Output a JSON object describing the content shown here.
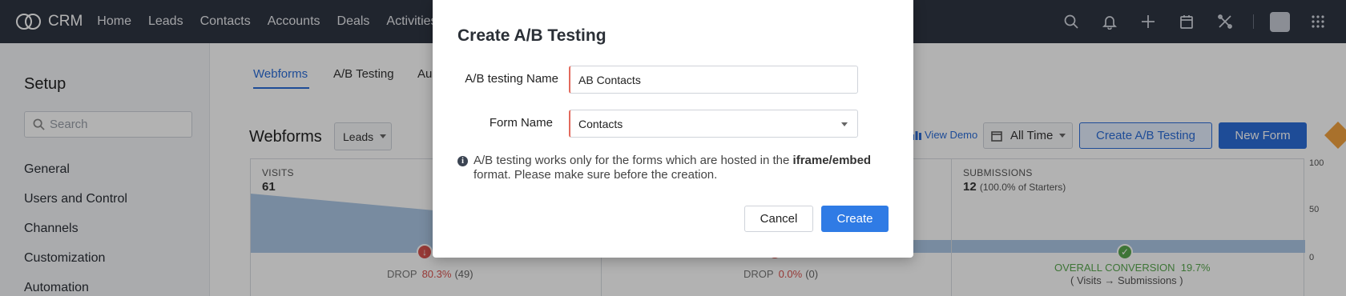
{
  "topnav": {
    "brand": "CRM",
    "links": [
      "Home",
      "Leads",
      "Contacts",
      "Accounts",
      "Deals",
      "Activities"
    ],
    "icons": [
      "search-icon",
      "bell-icon",
      "plus-icon",
      "calendar-icon",
      "tools-icon",
      "avatar",
      "apps-grid-icon"
    ]
  },
  "sidebar": {
    "title": "Setup",
    "search_placeholder": "Search",
    "items": [
      "General",
      "Users and Control",
      "Channels",
      "Customization",
      "Automation"
    ]
  },
  "main": {
    "tabs": [
      "Webforms",
      "A/B Testing",
      "Au"
    ],
    "active_tab": "Webforms",
    "page_title": "Webforms",
    "module_select": "Leads",
    "view_demo": "View Demo",
    "time_filter": "All Time",
    "create_ab_button": "Create A/B Testing",
    "new_form_button": "New Form",
    "funnel": {
      "visits_label": "VISITS",
      "visits_value": "61",
      "submissions_label": "SUBMISSIONS",
      "submissions_value": "12",
      "submissions_sub": "(100.0% of Starters)",
      "drop1_label": "DROP",
      "drop1_pct": "80.3%",
      "drop1_count": "(49)",
      "drop2_label": "DROP",
      "drop2_pct": "0.0%",
      "drop2_count": "(0)",
      "overall_label": "OVERALL CONVERSION",
      "overall_pct": "19.7%",
      "overall_sub": "( Visits → Submissions )",
      "y_ticks": [
        "100",
        "50",
        "0"
      ]
    }
  },
  "modal": {
    "title": "Create A/B Testing",
    "name_label": "A/B testing Name",
    "name_value": "AB Contacts",
    "form_label": "Form Name",
    "form_value": "Contacts",
    "info_pre": "A/B testing works only for the forms which are hosted in the ",
    "info_bold": "iframe/embed",
    "info_post": " format. Please make sure before the creation.",
    "cancel_button": "Cancel",
    "create_button": "Create"
  },
  "colors": {
    "nav_bg": "#2f3542",
    "primary": "#2b6dd8",
    "required_marker": "#e26a5d",
    "drop_red": "#d8534f",
    "conversion_green": "#59a84f"
  }
}
